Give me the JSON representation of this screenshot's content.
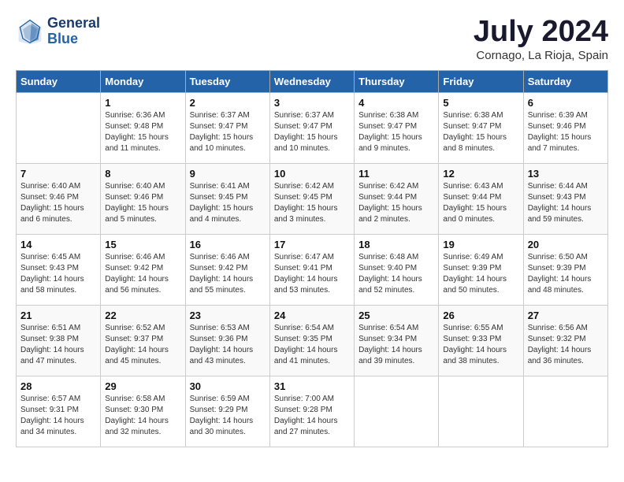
{
  "header": {
    "logo_line1": "General",
    "logo_line2": "Blue",
    "month_title": "July 2024",
    "location": "Cornago, La Rioja, Spain"
  },
  "weekdays": [
    "Sunday",
    "Monday",
    "Tuesday",
    "Wednesday",
    "Thursday",
    "Friday",
    "Saturday"
  ],
  "weeks": [
    [
      {
        "day": "",
        "sunrise": "",
        "sunset": "",
        "daylight": ""
      },
      {
        "day": "1",
        "sunrise": "Sunrise: 6:36 AM",
        "sunset": "Sunset: 9:48 PM",
        "daylight": "Daylight: 15 hours and 11 minutes."
      },
      {
        "day": "2",
        "sunrise": "Sunrise: 6:37 AM",
        "sunset": "Sunset: 9:47 PM",
        "daylight": "Daylight: 15 hours and 10 minutes."
      },
      {
        "day": "3",
        "sunrise": "Sunrise: 6:37 AM",
        "sunset": "Sunset: 9:47 PM",
        "daylight": "Daylight: 15 hours and 10 minutes."
      },
      {
        "day": "4",
        "sunrise": "Sunrise: 6:38 AM",
        "sunset": "Sunset: 9:47 PM",
        "daylight": "Daylight: 15 hours and 9 minutes."
      },
      {
        "day": "5",
        "sunrise": "Sunrise: 6:38 AM",
        "sunset": "Sunset: 9:47 PM",
        "daylight": "Daylight: 15 hours and 8 minutes."
      },
      {
        "day": "6",
        "sunrise": "Sunrise: 6:39 AM",
        "sunset": "Sunset: 9:46 PM",
        "daylight": "Daylight: 15 hours and 7 minutes."
      }
    ],
    [
      {
        "day": "7",
        "sunrise": "Sunrise: 6:40 AM",
        "sunset": "Sunset: 9:46 PM",
        "daylight": "Daylight: 15 hours and 6 minutes."
      },
      {
        "day": "8",
        "sunrise": "Sunrise: 6:40 AM",
        "sunset": "Sunset: 9:46 PM",
        "daylight": "Daylight: 15 hours and 5 minutes."
      },
      {
        "day": "9",
        "sunrise": "Sunrise: 6:41 AM",
        "sunset": "Sunset: 9:45 PM",
        "daylight": "Daylight: 15 hours and 4 minutes."
      },
      {
        "day": "10",
        "sunrise": "Sunrise: 6:42 AM",
        "sunset": "Sunset: 9:45 PM",
        "daylight": "Daylight: 15 hours and 3 minutes."
      },
      {
        "day": "11",
        "sunrise": "Sunrise: 6:42 AM",
        "sunset": "Sunset: 9:44 PM",
        "daylight": "Daylight: 15 hours and 2 minutes."
      },
      {
        "day": "12",
        "sunrise": "Sunrise: 6:43 AM",
        "sunset": "Sunset: 9:44 PM",
        "daylight": "Daylight: 15 hours and 0 minutes."
      },
      {
        "day": "13",
        "sunrise": "Sunrise: 6:44 AM",
        "sunset": "Sunset: 9:43 PM",
        "daylight": "Daylight: 14 hours and 59 minutes."
      }
    ],
    [
      {
        "day": "14",
        "sunrise": "Sunrise: 6:45 AM",
        "sunset": "Sunset: 9:43 PM",
        "daylight": "Daylight: 14 hours and 58 minutes."
      },
      {
        "day": "15",
        "sunrise": "Sunrise: 6:46 AM",
        "sunset": "Sunset: 9:42 PM",
        "daylight": "Daylight: 14 hours and 56 minutes."
      },
      {
        "day": "16",
        "sunrise": "Sunrise: 6:46 AM",
        "sunset": "Sunset: 9:42 PM",
        "daylight": "Daylight: 14 hours and 55 minutes."
      },
      {
        "day": "17",
        "sunrise": "Sunrise: 6:47 AM",
        "sunset": "Sunset: 9:41 PM",
        "daylight": "Daylight: 14 hours and 53 minutes."
      },
      {
        "day": "18",
        "sunrise": "Sunrise: 6:48 AM",
        "sunset": "Sunset: 9:40 PM",
        "daylight": "Daylight: 14 hours and 52 minutes."
      },
      {
        "day": "19",
        "sunrise": "Sunrise: 6:49 AM",
        "sunset": "Sunset: 9:39 PM",
        "daylight": "Daylight: 14 hours and 50 minutes."
      },
      {
        "day": "20",
        "sunrise": "Sunrise: 6:50 AM",
        "sunset": "Sunset: 9:39 PM",
        "daylight": "Daylight: 14 hours and 48 minutes."
      }
    ],
    [
      {
        "day": "21",
        "sunrise": "Sunrise: 6:51 AM",
        "sunset": "Sunset: 9:38 PM",
        "daylight": "Daylight: 14 hours and 47 minutes."
      },
      {
        "day": "22",
        "sunrise": "Sunrise: 6:52 AM",
        "sunset": "Sunset: 9:37 PM",
        "daylight": "Daylight: 14 hours and 45 minutes."
      },
      {
        "day": "23",
        "sunrise": "Sunrise: 6:53 AM",
        "sunset": "Sunset: 9:36 PM",
        "daylight": "Daylight: 14 hours and 43 minutes."
      },
      {
        "day": "24",
        "sunrise": "Sunrise: 6:54 AM",
        "sunset": "Sunset: 9:35 PM",
        "daylight": "Daylight: 14 hours and 41 minutes."
      },
      {
        "day": "25",
        "sunrise": "Sunrise: 6:54 AM",
        "sunset": "Sunset: 9:34 PM",
        "daylight": "Daylight: 14 hours and 39 minutes."
      },
      {
        "day": "26",
        "sunrise": "Sunrise: 6:55 AM",
        "sunset": "Sunset: 9:33 PM",
        "daylight": "Daylight: 14 hours and 38 minutes."
      },
      {
        "day": "27",
        "sunrise": "Sunrise: 6:56 AM",
        "sunset": "Sunset: 9:32 PM",
        "daylight": "Daylight: 14 hours and 36 minutes."
      }
    ],
    [
      {
        "day": "28",
        "sunrise": "Sunrise: 6:57 AM",
        "sunset": "Sunset: 9:31 PM",
        "daylight": "Daylight: 14 hours and 34 minutes."
      },
      {
        "day": "29",
        "sunrise": "Sunrise: 6:58 AM",
        "sunset": "Sunset: 9:30 PM",
        "daylight": "Daylight: 14 hours and 32 minutes."
      },
      {
        "day": "30",
        "sunrise": "Sunrise: 6:59 AM",
        "sunset": "Sunset: 9:29 PM",
        "daylight": "Daylight: 14 hours and 30 minutes."
      },
      {
        "day": "31",
        "sunrise": "Sunrise: 7:00 AM",
        "sunset": "Sunset: 9:28 PM",
        "daylight": "Daylight: 14 hours and 27 minutes."
      },
      {
        "day": "",
        "sunrise": "",
        "sunset": "",
        "daylight": ""
      },
      {
        "day": "",
        "sunrise": "",
        "sunset": "",
        "daylight": ""
      },
      {
        "day": "",
        "sunrise": "",
        "sunset": "",
        "daylight": ""
      }
    ]
  ]
}
